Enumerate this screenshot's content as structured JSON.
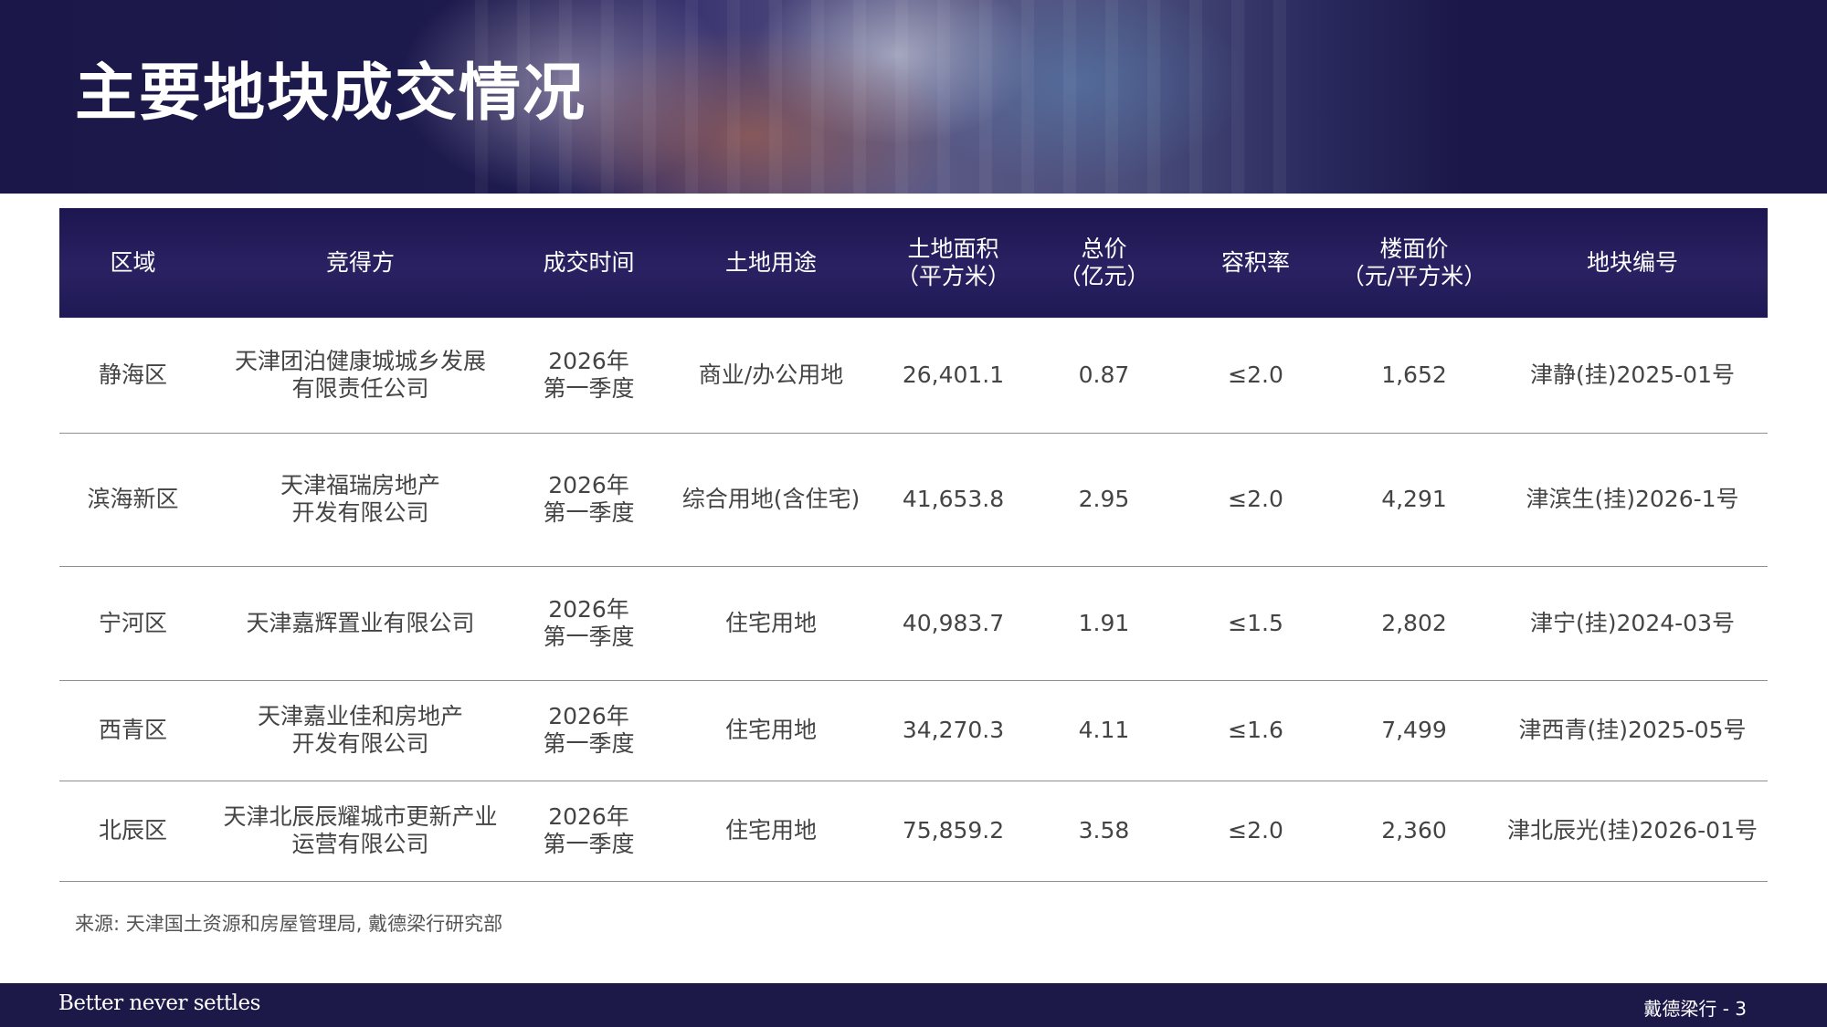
{
  "title": "主要地块成交情况",
  "table": {
    "headers": [
      [
        "区域"
      ],
      [
        "竞得方"
      ],
      [
        "成交时间"
      ],
      [
        "土地用途"
      ],
      [
        "土地面积",
        "（平方米）"
      ],
      [
        "总价",
        "（亿元）"
      ],
      [
        "容积率"
      ],
      [
        "楼面价",
        "（元/平方米）"
      ],
      [
        "地块编号"
      ]
    ],
    "rows": [
      {
        "district": "静海区",
        "buyer": [
          "天津团泊健康城城乡发展",
          "有限责任公司"
        ],
        "time": [
          "2026年",
          "第一季度"
        ],
        "use": "商业/办公用地",
        "area": "26,401.1",
        "price": "0.87",
        "far": "≤2.0",
        "floor_price": "1,652",
        "plot_no": "津静(挂)2025-01号"
      },
      {
        "district": "滨海新区",
        "buyer": [
          "天津福瑞房地产",
          "开发有限公司"
        ],
        "time": [
          "2026年",
          "第一季度"
        ],
        "use": "综合用地(含住宅)",
        "area": "41,653.8",
        "price": "2.95",
        "far": "≤2.0",
        "floor_price": "4,291",
        "plot_no": "津滨生(挂)2026-1号"
      },
      {
        "district": "宁河区",
        "buyer": [
          "天津嘉辉置业有限公司"
        ],
        "time": [
          "2026年",
          "第一季度"
        ],
        "use": "住宅用地",
        "area": "40,983.7",
        "price": "1.91",
        "far": "≤1.5",
        "floor_price": "2,802",
        "plot_no": "津宁(挂)2024-03号"
      },
      {
        "district": "西青区",
        "buyer": [
          "天津嘉业佳和房地产",
          "开发有限公司"
        ],
        "time": [
          "2026年",
          "第一季度"
        ],
        "use": "住宅用地",
        "area": "34,270.3",
        "price": "4.11",
        "far": "≤1.6",
        "floor_price": "7,499",
        "plot_no": "津西青(挂)2025-05号"
      },
      {
        "district": "北辰区",
        "buyer": [
          "天津北辰辰耀城市更新产业",
          "运营有限公司"
        ],
        "time": [
          "2026年",
          "第一季度"
        ],
        "use": "住宅用地",
        "area": "75,859.2",
        "price": "3.58",
        "far": "≤2.0",
        "floor_price": "2,360",
        "plot_no": "津北辰光(挂)2026-01号"
      }
    ]
  },
  "source": "来源: 天津国土资源和房屋管理局, 戴德梁行研究部",
  "footer": {
    "tagline": "Better never settles",
    "page_label": "戴德梁行 - 3"
  },
  "colors": {
    "navy": "#1c1848",
    "header_cell": "#2a2162",
    "text": "#444444"
  }
}
